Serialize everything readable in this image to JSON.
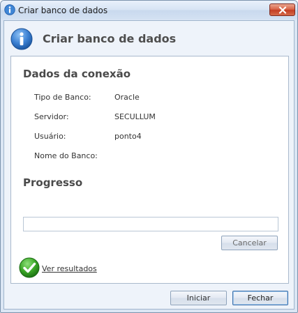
{
  "window": {
    "title": "Criar banco de dados"
  },
  "header": {
    "title": "Criar banco de dados",
    "icon": "info-icon"
  },
  "connection": {
    "section_title": "Dados da conexão",
    "fields": [
      {
        "label": "Tipo de Banco:",
        "value": "Oracle"
      },
      {
        "label": "Servidor:",
        "value": "SECULLUM"
      },
      {
        "label": "Usuário:",
        "value": "ponto4"
      },
      {
        "label": "Nome do Banco:",
        "value": ""
      }
    ]
  },
  "progress": {
    "section_title": "Progresso",
    "fraction": 0,
    "cancel_label": "Cancelar"
  },
  "results": {
    "icon": "check-icon",
    "link_label": "Ver resultados"
  },
  "footer": {
    "start_label": "Iniciar",
    "close_label": "Fechar"
  },
  "colors": {
    "accent": "#3d6fa8",
    "success": "#3aa626",
    "title_text": "#4e4e4e"
  }
}
